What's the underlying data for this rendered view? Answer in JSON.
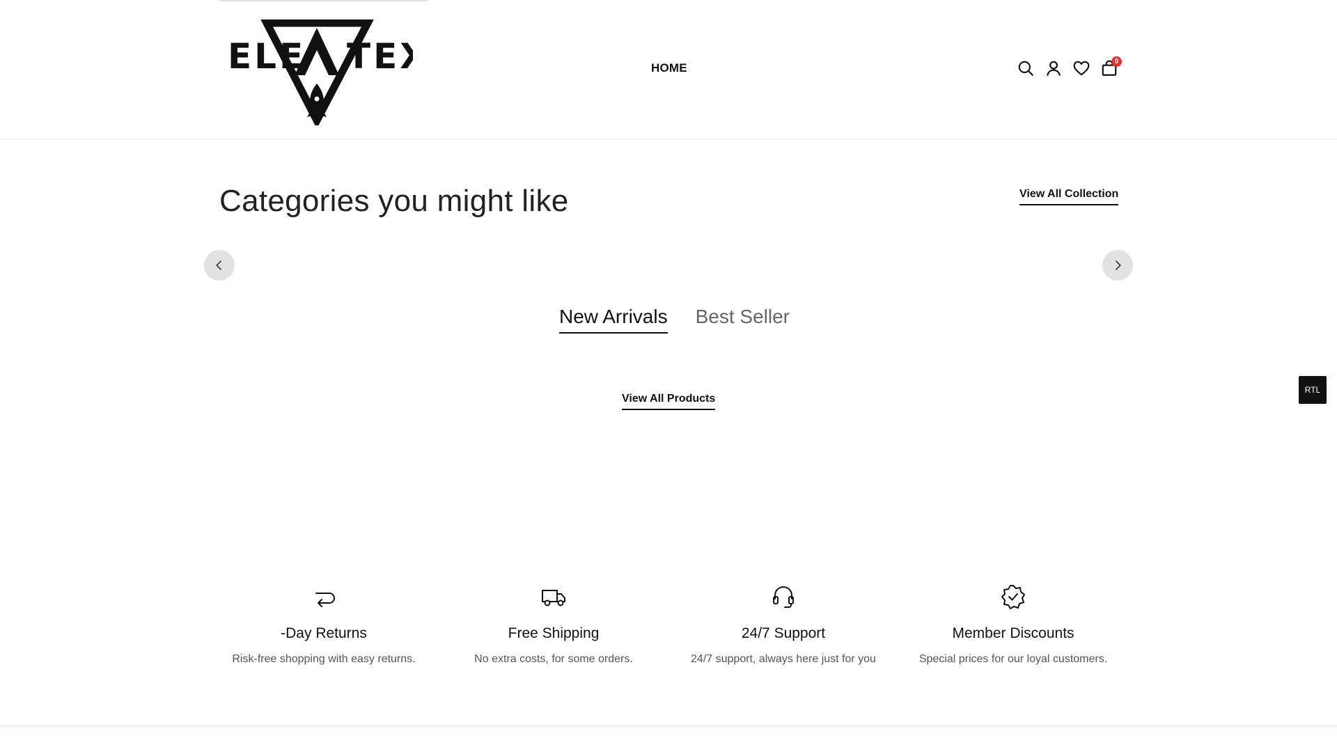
{
  "header": {
    "logo_text": "ELEVATEX",
    "nav": [
      {
        "label": "HOME"
      }
    ],
    "icons": [
      "search-icon",
      "user-icon",
      "heart-icon",
      "bag-icon"
    ],
    "cart_count": "0"
  },
  "categories": {
    "title": "Categories you might like",
    "view_all_label": "View All Collection"
  },
  "tabs": [
    {
      "label": "New Arrivals",
      "active": true
    },
    {
      "label": "Best Seller",
      "active": false
    }
  ],
  "view_all_products_label": "View All Products",
  "rtl_label": "RTL",
  "features": [
    {
      "icon": "return-arrow-icon",
      "title": "-Day Returns",
      "desc": "Risk-free shopping with easy returns."
    },
    {
      "icon": "truck-icon",
      "title": "Free Shipping",
      "desc": "No extra costs, for some orders."
    },
    {
      "icon": "headset-icon",
      "title": "24/7 Support",
      "desc": "24/7 support, always here just for you"
    },
    {
      "icon": "badge-check-icon",
      "title": "Member Discounts",
      "desc": "Special prices for our loyal customers."
    }
  ],
  "colors": {
    "badge": "#e5322d",
    "text": "#222222",
    "muted": "#555555",
    "arrow_bg": "#e2e2e2"
  }
}
